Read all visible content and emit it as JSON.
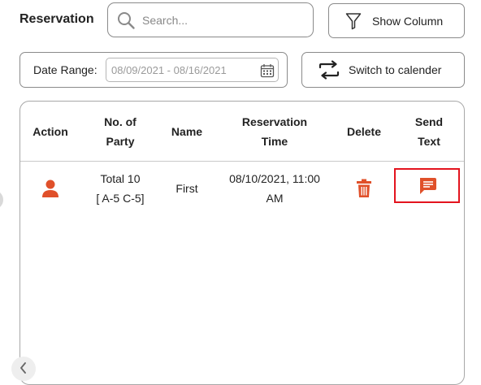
{
  "header": {
    "title": "Reservation",
    "search_placeholder": "Search...",
    "show_column_label": "Show Column"
  },
  "filters": {
    "date_range_label": "Date Range:",
    "date_range_value": "08/09/2021 - 08/16/2021",
    "switch_label": "Switch to calender"
  },
  "table": {
    "columns": {
      "action": "Action",
      "party_line1": "No. of",
      "party_line2": "Party",
      "name": "Name",
      "time_line1": "Reservation",
      "time_line2": "Time",
      "delete": "Delete",
      "send_line1": "Send",
      "send_line2": "Text"
    },
    "rows": [
      {
        "party_total": "Total 10",
        "party_detail": "[ A-5 C-5]",
        "name": "First",
        "time_line1": "08/10/2021, 11:00",
        "time_line2": "AM"
      }
    ]
  },
  "icons": {
    "search": "search-icon",
    "filter": "filter-funnel-icon",
    "switch": "swap-arrows-icon",
    "calendar": "calendar-icon",
    "user": "user-icon",
    "trash": "trash-icon",
    "message": "message-icon",
    "chevron_left": "chevron-left-icon"
  },
  "colors": {
    "accent": "#e0502a",
    "highlight": "#e3141e",
    "border": "#8a8a8a"
  }
}
